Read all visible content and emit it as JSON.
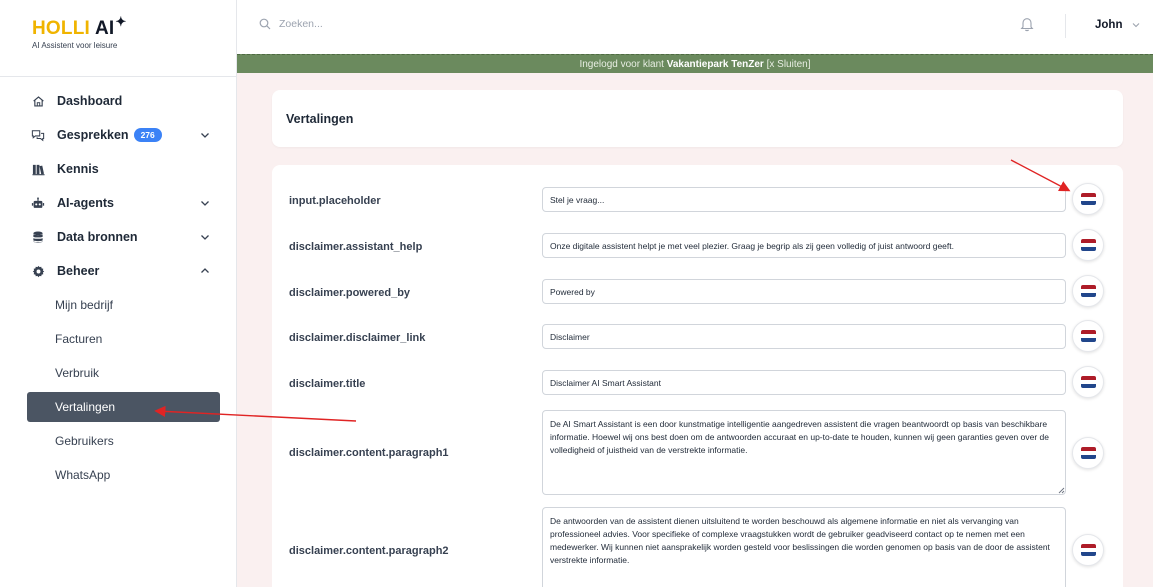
{
  "brand": {
    "name": "HOLLI",
    "ai": "AI",
    "tagline": "AI Assistent voor leisure"
  },
  "header": {
    "search_placeholder": "Zoeken...",
    "user_name": "John"
  },
  "banner": {
    "prefix": "Ingelogd voor klant ",
    "client": "Vakantiepark TenZer",
    "suffix": " [x Sluiten]"
  },
  "sidebar": {
    "items": [
      {
        "label": "Dashboard",
        "icon": "home-icon"
      },
      {
        "label": "Gesprekken",
        "icon": "chat-icon",
        "badge": "276"
      },
      {
        "label": "Kennis",
        "icon": "books-icon"
      },
      {
        "label": "AI-agents",
        "icon": "robot-icon"
      },
      {
        "label": "Data bronnen",
        "icon": "database-icon"
      },
      {
        "label": "Beheer",
        "icon": "gear-icon"
      }
    ],
    "beheer_items": [
      {
        "label": "Mijn bedrijf"
      },
      {
        "label": "Facturen"
      },
      {
        "label": "Verbruik"
      },
      {
        "label": "Vertalingen"
      },
      {
        "label": "Gebruikers"
      },
      {
        "label": "WhatsApp"
      }
    ],
    "active": "Vertalingen"
  },
  "page": {
    "title": "Vertalingen"
  },
  "translations": [
    {
      "key": "input.placeholder",
      "value": "Stel je vraag..."
    },
    {
      "key": "disclaimer.assistant_help",
      "value": "Onze digitale assistent helpt je met veel plezier. Graag je begrip als zij geen volledig of juist antwoord geeft."
    },
    {
      "key": "disclaimer.powered_by",
      "value": "Powered by"
    },
    {
      "key": "disclaimer.disclaimer_link",
      "value": "Disclaimer"
    },
    {
      "key": "disclaimer.title",
      "value": "Disclaimer AI Smart Assistant"
    },
    {
      "key": "disclaimer.content.paragraph1",
      "value": "De AI Smart Assistant is een door kunstmatige intelligentie aangedreven assistent die vragen beantwoordt op basis van beschikbare informatie. Hoewel wij ons best doen om de antwoorden accuraat en up-to-date te houden, kunnen wij geen garanties geven over de volledigheid of juistheid van de verstrekte informatie."
    },
    {
      "key": "disclaimer.content.paragraph2",
      "value": "De antwoorden van de assistent dienen uitsluitend te worden beschouwd als algemene informatie en niet als vervanging van professioneel advies. Voor specifieke of complexe vraagstukken wordt de gebruiker geadviseerd contact op te nemen met een medewerker. Wij kunnen niet aansprakelijk worden gesteld voor beslissingen die worden genomen op basis van de door de assistent verstrekte informatie."
    }
  ],
  "colors": {
    "banner": "#6b8a5e",
    "badge": "#3b82f6",
    "active_nav": "#4b5563",
    "annotation_arrow": "#e02424",
    "flag_red": "#ae1c28",
    "flag_white": "#ffffff",
    "flag_blue": "#21468b"
  }
}
